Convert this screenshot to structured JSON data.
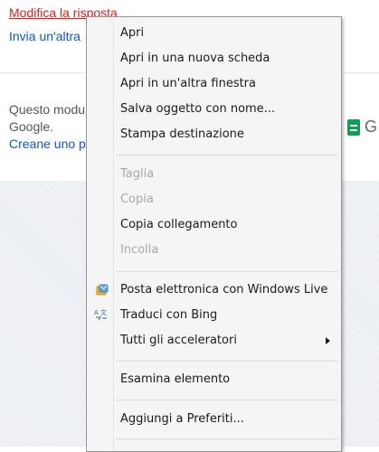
{
  "background_page": {
    "link_modifica": "Modifica la risposta",
    "link_invia": "Invia un'altra",
    "footer_line1": "Questo modu",
    "footer_line2": "Google.",
    "footer_line3": "Creane uno p",
    "g_letter": "G"
  },
  "context_menu": {
    "items": [
      {
        "label": "Apri",
        "enabled": true
      },
      {
        "label": "Apri in una nuova scheda",
        "enabled": true
      },
      {
        "label": "Apri in un'altra finestra",
        "enabled": true
      },
      {
        "label": "Salva oggetto con nome...",
        "enabled": true
      },
      {
        "label": "Stampa destinazione",
        "enabled": true
      },
      {
        "label": "Taglia",
        "enabled": false
      },
      {
        "label": "Copia",
        "enabled": false
      },
      {
        "label": "Copia collegamento",
        "enabled": true
      },
      {
        "label": "Incolla",
        "enabled": false
      },
      {
        "label": "Posta elettronica con Windows Live",
        "enabled": true,
        "icon": "windows-live-mail-icon"
      },
      {
        "label": "Traduci con Bing",
        "enabled": true,
        "icon": "bing-translate-icon"
      },
      {
        "label": "Tutti gli acceleratori",
        "enabled": true,
        "submenu": true
      },
      {
        "label": "Esamina elemento",
        "enabled": true
      },
      {
        "label": "Aggiungi a Preferiti...",
        "enabled": true
      }
    ]
  },
  "colors": {
    "link_red": "#e01b1b",
    "link_blue": "#1155cc",
    "menu_bg": "#f5f5f5",
    "disabled_text": "#a8a8a8",
    "sheets_green": "#0f9d58"
  }
}
